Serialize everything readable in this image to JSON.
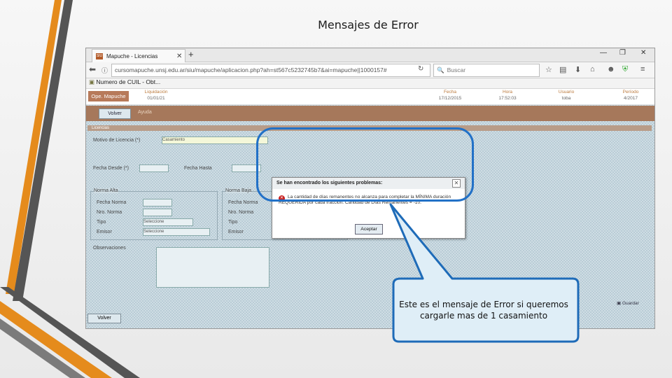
{
  "slide": {
    "title": "Mensajes de Error",
    "callout_text": "Este es el mensaje de Error si queremos cargarle mas de 1 casamiento"
  },
  "browser": {
    "tab_title": "Mapuche - Licencias",
    "favicon_text": "SIU",
    "new_tab": "+",
    "close_tab": "✕",
    "url": "cursomapuche.unsj.edu.ar/siu/mapuche/aplicacion.php?ah=st567c5232745b7&ai=mapuche||1000157#",
    "search_placeholder": "Buscar",
    "bookmark": "Numero de CUIL - Obt..."
  },
  "app": {
    "op_label": "Ope. Mapuche",
    "header_cols": [
      {
        "label": "Liquidación",
        "value": "01/01/21"
      },
      {
        "label": "Fecha",
        "value": "17/12/2015"
      },
      {
        "label": "Hora",
        "value": "17:52:03"
      },
      {
        "label": "Usuario",
        "value": "toba"
      },
      {
        "label": "Período",
        "value": "4/2017"
      }
    ],
    "volver_label": "Volver",
    "ayuda_label": "Ayuda",
    "section_title": "Licencias",
    "fields": {
      "motivo": "Motivo de Licencia (*)",
      "motivo_value": "Casamiento",
      "fecha_desde": "Fecha Desde (*)",
      "fecha_hasta": "Fecha Hasta",
      "norma_alta": "Norma Alta",
      "norma_baja": "Norma Baja",
      "observaciones": "Observaciones",
      "fecha_norma": "Fecha Norma",
      "nro_norma": "Nro. Norma",
      "tipo": "Tipo",
      "emisor": "Emisor",
      "tipo_select": "Seleccione",
      "emisor_select": "Seleccione"
    },
    "bottom_left_btn": "Volver",
    "bottom_right_btn": "Guardar"
  },
  "dialog": {
    "title": "Se han encontrado los siguientes problemas:",
    "close": "✕",
    "message": "La cantidad de días remanentes no alcanza para completar la MÍNIMA duración REQUERIDA por cada fracción. Cantidad de Días Remanentes = -10.",
    "accept": "Aceptar"
  },
  "colors": {
    "accent_orange": "#e8901e",
    "accent_dark": "#3a3a3a",
    "highlight_blue": "#2271c7",
    "callout_fill": "#dfeef7"
  }
}
